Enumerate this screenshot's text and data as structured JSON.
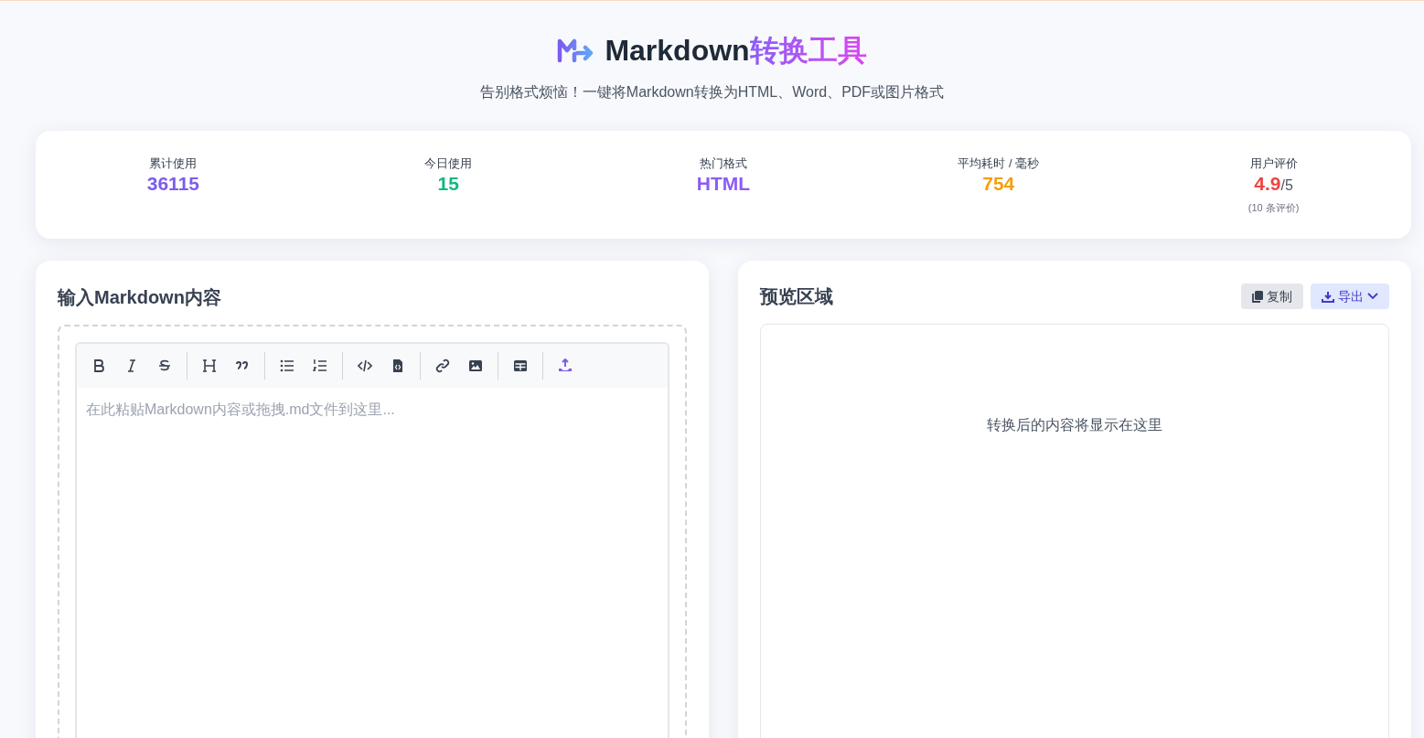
{
  "header": {
    "title": "Markdown",
    "title_accent": "转换工具",
    "subtitle": "告别格式烦恼！一键将Markdown转换为HTML、Word、PDF或图片格式"
  },
  "stats": [
    {
      "label": "累计使用",
      "value": "36115",
      "color": "#7c5cf0"
    },
    {
      "label": "今日使用",
      "value": "15",
      "color": "#10b981"
    },
    {
      "label": "热门格式",
      "value": "HTML",
      "color": "#8b5cf6"
    },
    {
      "label": "平均耗时 / 毫秒",
      "value": "754",
      "color": "#f59e0b"
    },
    {
      "label": "用户评价",
      "value": "4.9",
      "suffix": "/5",
      "note": "(10 条评价)",
      "color": "#ef4444"
    }
  ],
  "editor": {
    "title": "输入Markdown内容",
    "placeholder": "在此粘贴Markdown内容或拖拽.md文件到这里...",
    "toolbar": [
      [
        {
          "kind": "bold",
          "active": false
        },
        {
          "kind": "italic",
          "active": false
        },
        {
          "kind": "strike",
          "active": false
        }
      ],
      [
        {
          "kind": "heading",
          "active": false
        },
        {
          "kind": "quote",
          "active": false
        }
      ],
      [
        {
          "kind": "ul",
          "active": false
        },
        {
          "kind": "ol",
          "active": false
        }
      ],
      [
        {
          "kind": "code",
          "active": false
        },
        {
          "kind": "codefile",
          "active": false
        }
      ],
      [
        {
          "kind": "link",
          "active": false
        },
        {
          "kind": "image",
          "active": false
        }
      ],
      [
        {
          "kind": "table",
          "active": false
        }
      ],
      [
        {
          "kind": "upload",
          "active": true
        }
      ]
    ]
  },
  "preview": {
    "title": "预览区域",
    "copy_button": "复制",
    "export_button": "导出",
    "empty_text": "转换后的内容将显示在这里"
  }
}
